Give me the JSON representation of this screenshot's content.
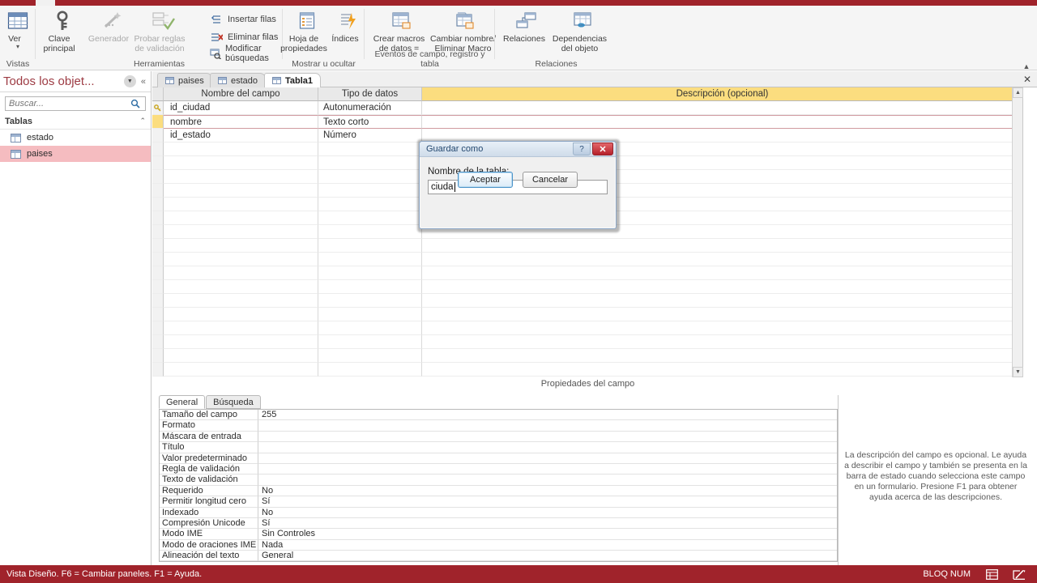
{
  "ribbon": {
    "groups": [
      {
        "label": "Vistas"
      },
      {
        "label": "Herramientas"
      },
      {
        "label": "Mostrar u ocultar"
      },
      {
        "label": "Eventos de campo, registro y tabla"
      },
      {
        "label": "Relaciones"
      }
    ],
    "buttons": {
      "ver": "Ver",
      "clave_principal": "Clave\nprincipal",
      "generador": "Generador",
      "probar_reglas": "Probar reglas\nde validación",
      "insertar_filas": "Insertar filas",
      "eliminar_filas": "Eliminar filas",
      "modificar_busquedas": "Modificar búsquedas",
      "hoja_propiedades": "Hoja de\npropiedades",
      "indices": "Índices",
      "crear_macros": "Crear macros\nde datos =",
      "cambiar_nombre": "Cambiar nombre/\nEliminar Macro",
      "relaciones": "Relaciones",
      "dependencias": "Dependencias\ndel objeto"
    }
  },
  "navpane": {
    "title": "Todos los objet...",
    "search_placeholder": "Buscar...",
    "group_label": "Tablas",
    "items": [
      {
        "label": "estado",
        "selected": false
      },
      {
        "label": "paises",
        "selected": true
      }
    ]
  },
  "doc_tabs": [
    {
      "label": "paises",
      "active": false
    },
    {
      "label": "estado",
      "active": false
    },
    {
      "label": "Tabla1",
      "active": true
    }
  ],
  "grid": {
    "headers": {
      "name": "Nombre del campo",
      "type": "Tipo de datos",
      "description": "Descripción (opcional)"
    },
    "rows": [
      {
        "name": "id_ciudad",
        "type": "Autonumeración",
        "description": "",
        "primary_key": true,
        "current": false
      },
      {
        "name": "nombre",
        "type": "Texto corto",
        "description": "",
        "primary_key": false,
        "current": true
      },
      {
        "name": "id_estado",
        "type": "Número",
        "description": "",
        "primary_key": false,
        "current": false
      }
    ],
    "empty_rows": 17
  },
  "properties": {
    "caption": "Propiedades del campo",
    "tabs": [
      {
        "label": "General",
        "active": true
      },
      {
        "label": "Búsqueda",
        "active": false
      }
    ],
    "rows": [
      {
        "name": "Tamaño del campo",
        "value": "255"
      },
      {
        "name": "Formato",
        "value": ""
      },
      {
        "name": "Máscara de entrada",
        "value": ""
      },
      {
        "name": "Título",
        "value": ""
      },
      {
        "name": "Valor predeterminado",
        "value": ""
      },
      {
        "name": "Regla de validación",
        "value": ""
      },
      {
        "name": "Texto de validación",
        "value": ""
      },
      {
        "name": "Requerido",
        "value": "No"
      },
      {
        "name": "Permitir longitud cero",
        "value": "Sí"
      },
      {
        "name": "Indexado",
        "value": "No"
      },
      {
        "name": "Compresión Unicode",
        "value": "Sí"
      },
      {
        "name": "Modo IME",
        "value": "Sin Controles"
      },
      {
        "name": "Modo de oraciones IME",
        "value": "Nada"
      },
      {
        "name": "Alineación del texto",
        "value": "General"
      }
    ],
    "help_text": "La descripción del campo es opcional. Le ayuda a describir el campo y también se presenta en la barra de estado cuando selecciona este campo en un formulario. Presione F1 para obtener ayuda acerca de las descripciones."
  },
  "dialog": {
    "title": "Guardar como",
    "field_label": "Nombre de la tabla:",
    "field_value": "ciuda",
    "accept_label": "Aceptar",
    "cancel_label": "Cancelar",
    "help_glyph": "?",
    "close_glyph": "✕"
  },
  "statusbar": {
    "left_text": "Vista Diseño.  F6 = Cambiar paneles.  F1 = Ayuda.",
    "num_lock": "BLOQ NUM"
  },
  "colors": {
    "accent_red": "#a0232b",
    "header_gold": "#fbdd7f",
    "nav_selected": "#f5bcc0"
  }
}
